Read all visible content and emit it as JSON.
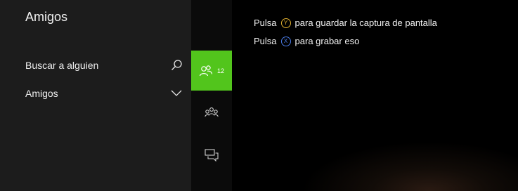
{
  "panel": {
    "title": "Amigos",
    "search_label": "Buscar a alguien",
    "search_icon": "search-icon",
    "friends_label": "Amigos",
    "friends_icon": "chevron-down-icon"
  },
  "rail": {
    "items": [
      {
        "icon": "friends-icon",
        "badge": "12",
        "active": true
      },
      {
        "icon": "clubs-icon",
        "active": false
      },
      {
        "icon": "messages-icon",
        "active": false
      }
    ],
    "accent": "#52c51c"
  },
  "overlay": {
    "hint1": {
      "prefix": "Pulsa",
      "button": "Y",
      "text": "para guardar la captura de pantalla"
    },
    "hint2": {
      "prefix": "Pulsa",
      "button": "X",
      "text": "para grabar eso"
    },
    "y_color": "#e0b030",
    "x_color": "#4a7ce8"
  }
}
